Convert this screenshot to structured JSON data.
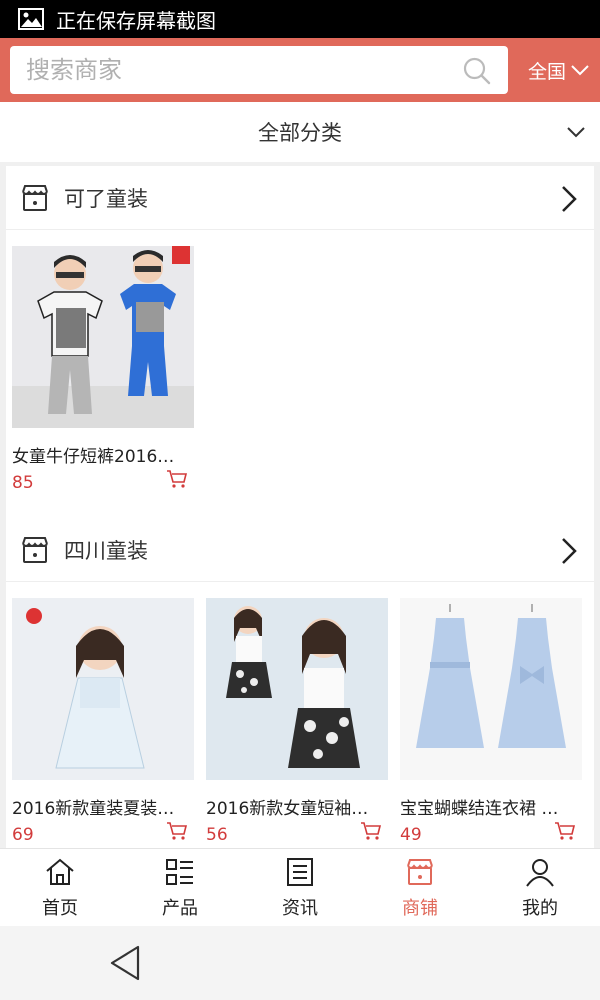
{
  "status_bar": {
    "text": "正在保存屏幕截图"
  },
  "search": {
    "placeholder": "搜索商家",
    "region": "全国"
  },
  "category": {
    "label": "全部分类"
  },
  "shops": [
    {
      "name": "可了童装",
      "products": [
        {
          "title": "女童牛仔短裤2016…",
          "price": "85"
        }
      ]
    },
    {
      "name": "四川童装",
      "products": [
        {
          "title": "2016新款童装夏装…",
          "price": "69"
        },
        {
          "title": "2016新款女童短袖…",
          "price": "56"
        },
        {
          "title": "宝宝蝴蝶结连衣裙 …",
          "price": "49"
        }
      ]
    }
  ],
  "nav": [
    {
      "label": "首页",
      "icon": "home-icon"
    },
    {
      "label": "产品",
      "icon": "list-icon"
    },
    {
      "label": "资讯",
      "icon": "news-icon"
    },
    {
      "label": "商铺",
      "icon": "store-icon",
      "active": true
    },
    {
      "label": "我的",
      "icon": "user-icon"
    }
  ],
  "colors": {
    "brand": "#e0695a",
    "price": "#d23b3b"
  }
}
